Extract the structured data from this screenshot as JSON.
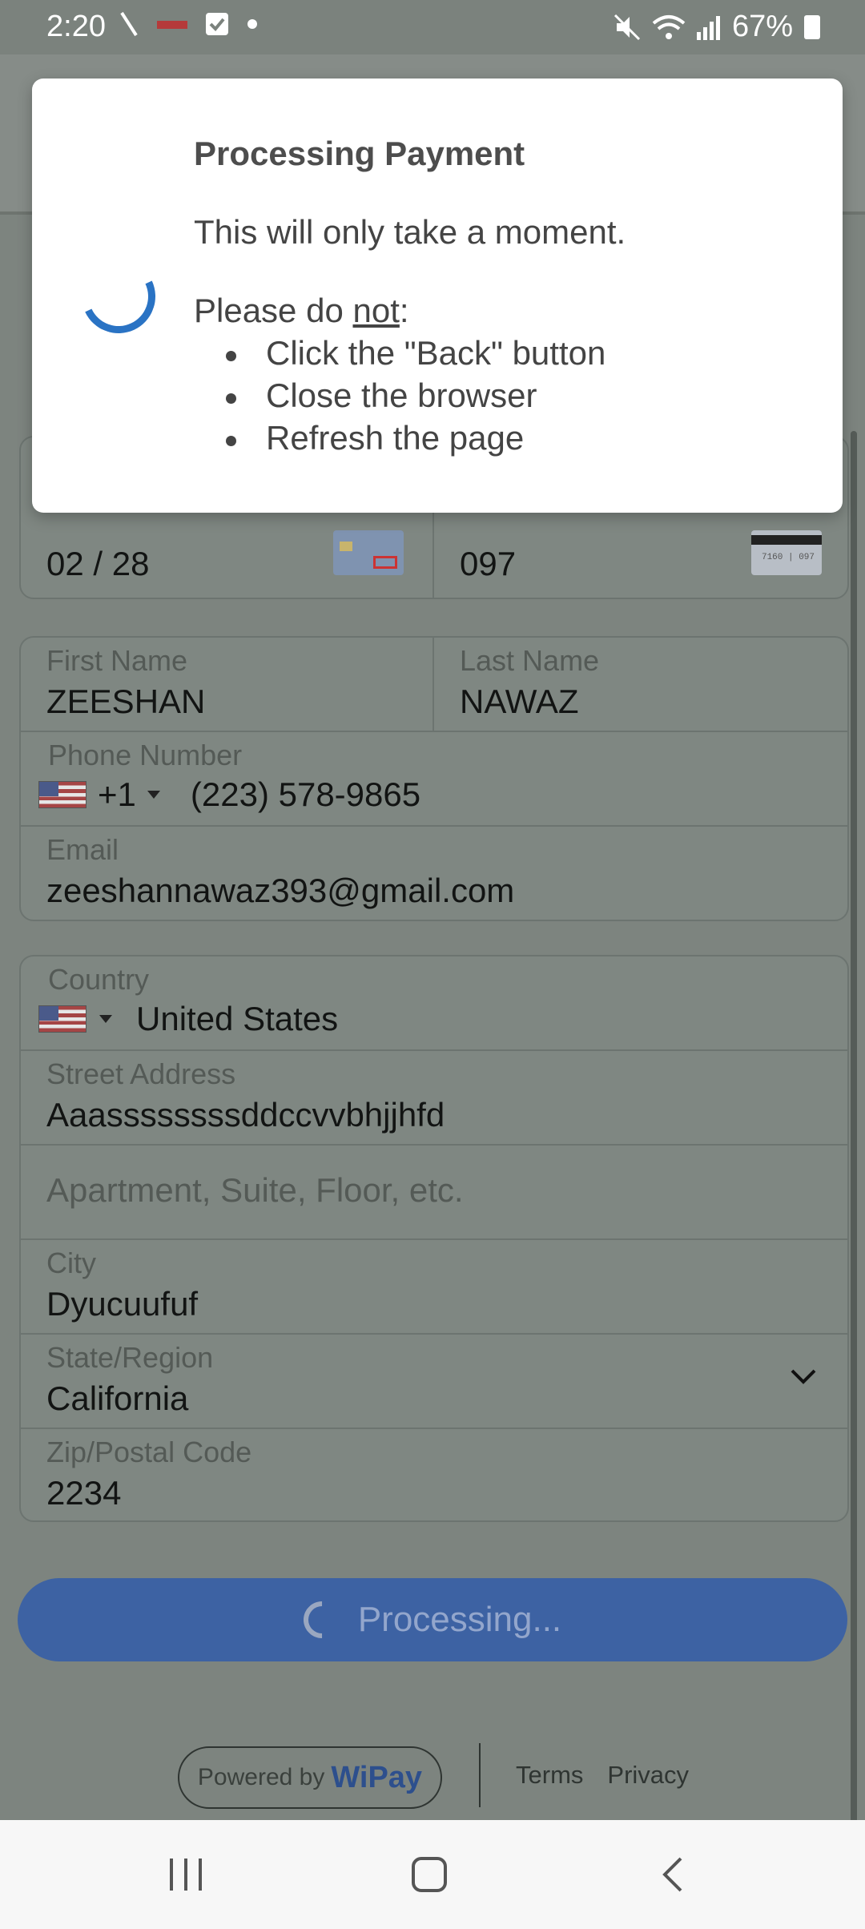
{
  "status_bar": {
    "time": "2:20",
    "battery": "67%"
  },
  "card": {
    "expiry": "02 / 28",
    "cvc": "097",
    "cvc_icon_digits": "7160 | 097"
  },
  "contact": {
    "first_name_label": "First Name",
    "first_name": "ZEESHAN",
    "last_name_label": "Last Name",
    "last_name": "NAWAZ",
    "phone_label": "Phone Number",
    "dial_code": "+1",
    "phone": "(223) 578-9865",
    "email_label": "Email",
    "email": "zeeshannawaz393@gmail.com"
  },
  "address": {
    "country_label": "Country",
    "country": "United States",
    "street_label": "Street Address",
    "street": "Aaassssssssddccvvbhjjhfd",
    "apt_placeholder": "Apartment, Suite, Floor, etc.",
    "city_label": "City",
    "city": "Dyucuufuf",
    "state_label": "State/Region",
    "state": "California",
    "zip_label": "Zip/Postal Code",
    "zip": "2234"
  },
  "submit": {
    "label": "Processing..."
  },
  "footer": {
    "powered_by": "Powered by",
    "brand": "WiPay",
    "terms": "Terms",
    "privacy": "Privacy"
  },
  "modal": {
    "title": "Processing Payment",
    "message": "This will only take a moment.",
    "please_prefix": "Please do ",
    "please_not": "not",
    "please_suffix": ":",
    "items": [
      "Click the \"Back\" button",
      "Close the browser",
      "Refresh the page"
    ]
  }
}
